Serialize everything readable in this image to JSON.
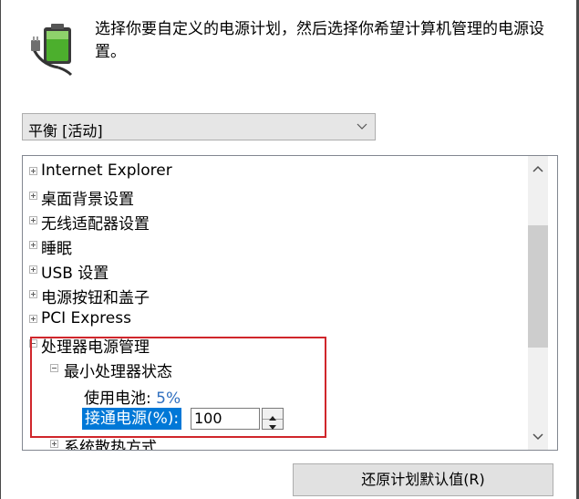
{
  "header": {
    "description": "选择你要自定义的电源计划，然后选择你希望计算机管理的电源设置。",
    "icon": "power-plan-battery-plug-icon"
  },
  "plan_select": {
    "selected": "平衡 [活动]",
    "icon": "chevron-down-icon"
  },
  "tree": {
    "items": [
      {
        "label": "Internet Explorer",
        "expander": "plus"
      },
      {
        "label": "桌面背景设置",
        "expander": "plus"
      },
      {
        "label": "无线适配器设置",
        "expander": "plus"
      },
      {
        "label": "睡眠",
        "expander": "plus"
      },
      {
        "label": "USB 设置",
        "expander": "plus"
      },
      {
        "label": "电源按钮和盖子",
        "expander": "plus"
      },
      {
        "label": "PCI Express",
        "expander": "plus"
      },
      {
        "label": "处理器电源管理",
        "expander": "minus"
      },
      {
        "label": "最小处理器状态",
        "expander": "minus"
      },
      {
        "label": "系统散热方式",
        "expander": "plus"
      }
    ],
    "battery": {
      "label": "使用电池:",
      "value": "5%"
    },
    "ac": {
      "label": "接通电源(%):",
      "value": "100"
    },
    "highlight_color": "#d0262b",
    "selection_color": "#0078d7"
  },
  "buttons": {
    "restore": "还原计划默认值(R)"
  }
}
